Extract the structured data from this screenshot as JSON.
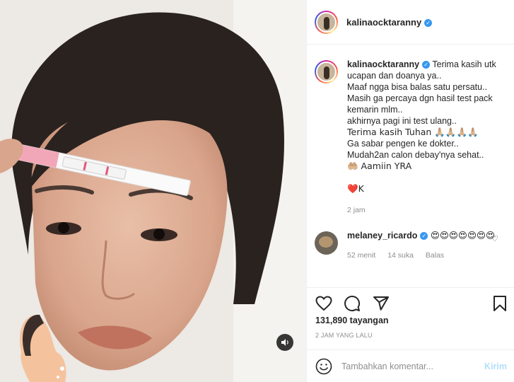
{
  "post": {
    "author": "kalinaocktaranny",
    "caption_lines": [
      "Terima kasih utk",
      "ucapan dan doanya ya..",
      "Maaf ngga bisa balas satu persatu..",
      "Masih ga percaya dgn hasil test pack",
      "kemarin mlm..",
      "akhirnya pagi ini test ulang..",
      "Terima kasih Tuhan 🙏🏼🙏🏼🙏🏼🙏🏼",
      "Ga sabar pengen ke dokter..",
      "Mudah2an calon debay'nya sehat..",
      "🤲🏼 Aamiin YRA"
    ],
    "signature": "❤️K",
    "caption_time": "2 jam",
    "views": "131,890 tayangan",
    "date": "2 JAM YANG LALU"
  },
  "comment": {
    "author": "melaney_ricardo",
    "text": "😍😍😍😍😍😍😍",
    "time": "52 menit",
    "likes": "14 suka",
    "reply": "Balas"
  },
  "composer": {
    "placeholder": "Tambahkan komentar...",
    "post_label": "Kirim"
  },
  "colors": {
    "verified": "#3897f0",
    "post_button_disabled": "#b2dffc",
    "secondary_text": "#8e8e8e"
  },
  "icons": [
    "verified-icon",
    "heart-icon",
    "comment-icon",
    "share-icon",
    "bookmark-icon",
    "smile-icon",
    "sound-icon"
  ]
}
